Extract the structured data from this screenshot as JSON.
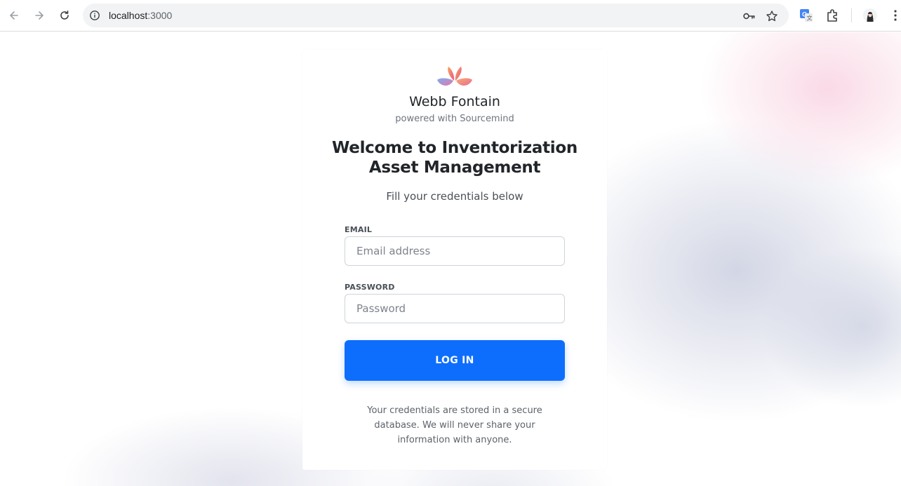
{
  "browser": {
    "url_host": "localhost",
    "url_port": ":3000"
  },
  "brand": {
    "name": "Webb Fontain",
    "powered_by": "powered with Sourcemind"
  },
  "login": {
    "title": "Welcome to Inventorization Asset Management",
    "subtitle": "Fill your credentials below",
    "email_label": "EMAIL",
    "email_placeholder": "Email address",
    "email_value": "",
    "password_label": "PASSWORD",
    "password_placeholder": "Password",
    "password_value": "",
    "button_label": "LOG IN",
    "footnote": "Your credentials are stored in a secure database. We will never share your information with anyone."
  },
  "colors": {
    "primary": "#0d6efd",
    "text": "#212529",
    "muted": "#6c757d"
  }
}
